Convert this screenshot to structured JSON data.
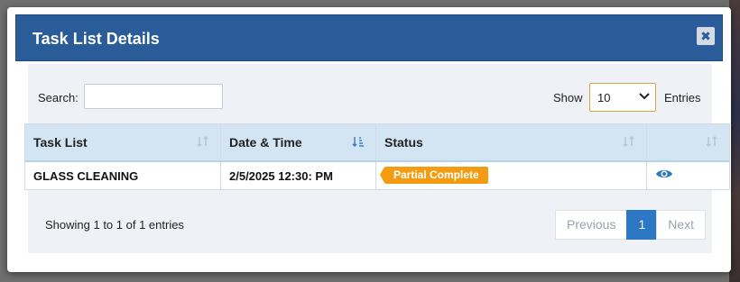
{
  "modal": {
    "title": "Task List Details",
    "close_label": "✖"
  },
  "controls": {
    "search_label": "Search:",
    "search_value": "",
    "show_label": "Show",
    "show_value": "10",
    "entries_label": "Entries"
  },
  "table": {
    "headers": [
      "Task List",
      "Date & Time",
      "Status",
      ""
    ],
    "rows": [
      {
        "task_list": "GLASS CLEANING",
        "date_time": "2/5/2025 12:30: PM",
        "status": "Partial Complete"
      }
    ]
  },
  "footer": {
    "summary": "Showing 1 to 1 of 1 entries",
    "previous": "Previous",
    "page": "1",
    "next": "Next"
  },
  "colors": {
    "header_bg": "#2b5c9a",
    "status_badge": "#f39c12",
    "active_page": "#2d78c4"
  },
  "icons": [
    "close-icon",
    "sort-icon",
    "sort-down-icon",
    "eye-icon",
    "chevron-down-icon"
  ]
}
